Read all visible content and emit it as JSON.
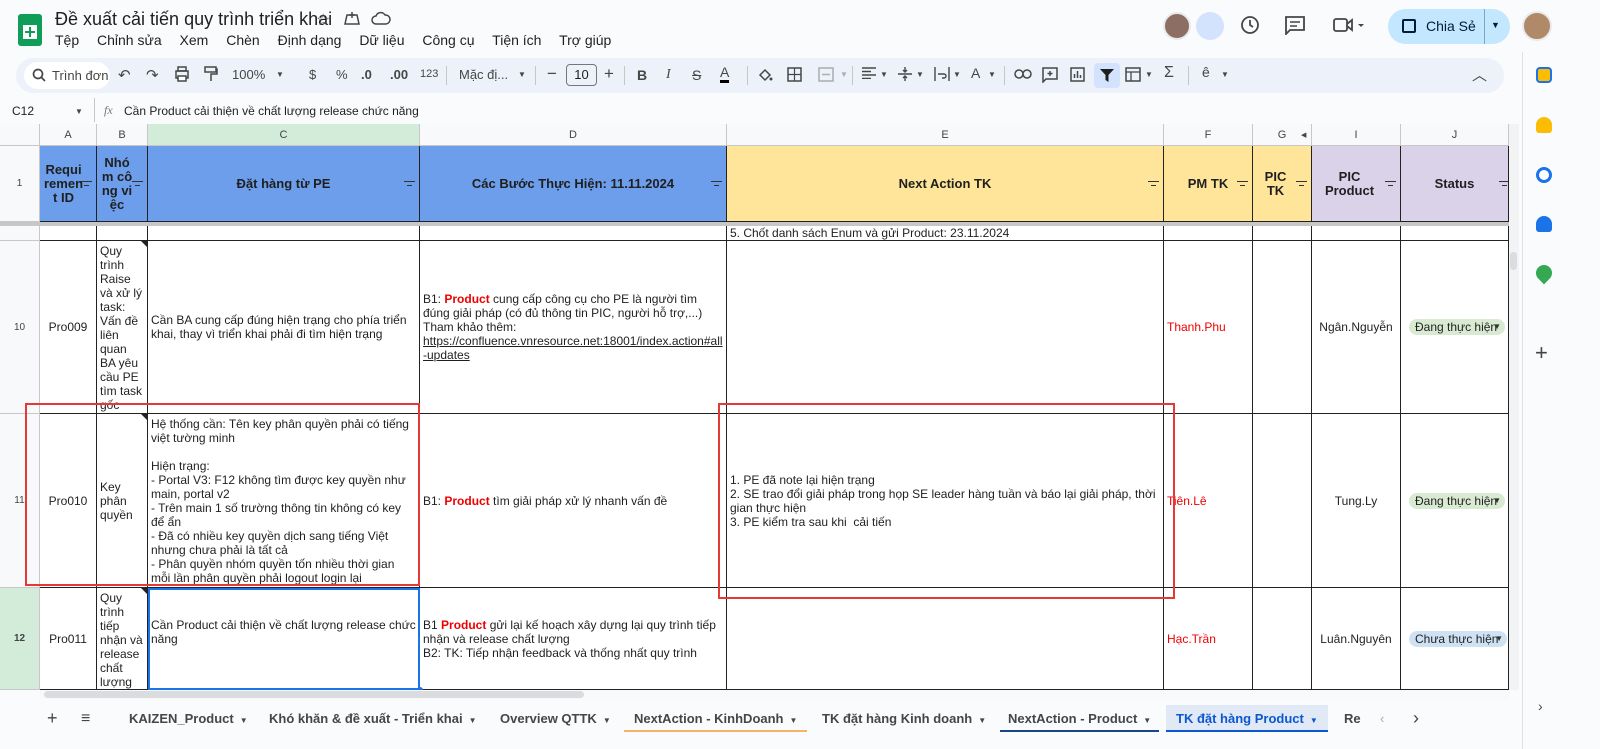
{
  "header": {
    "doc_title": "Đề xuất cải tiến quy trình triển khai",
    "share_label": "Chia Sẻ",
    "menus": [
      "Tệp",
      "Chỉnh sửa",
      "Xem",
      "Chèn",
      "Định dạng",
      "Dữ liệu",
      "Công cụ",
      "Tiện ích",
      "Trợ giúp"
    ]
  },
  "toolbar": {
    "search_placeholder": "Trình đơn",
    "zoom": "100%",
    "currency": "$",
    "percent": "%",
    "dec_decrease": ".0",
    "dec_increase": ".00",
    "number_format": "123",
    "font_name": "Mặc đị...",
    "font_size": "10"
  },
  "formula_bar": {
    "cell_ref": "C12",
    "fx": "fx",
    "content": "Cần Product cải thiện về chất lượng release chức năng"
  },
  "columns": [
    "A",
    "B",
    "C",
    "D",
    "E",
    "F",
    "G",
    "I",
    "J"
  ],
  "header_row": {
    "row_num": "1",
    "a": "Requirement ID",
    "b": "Nhóm công việc",
    "c": "Đặt hàng từ PE",
    "d": "Các Bước Thực Hiện: 11.11.2024",
    "e": "Next Action TK",
    "f": "PM TK",
    "g": "PIC TK",
    "i": "PIC Product",
    "j": "Status"
  },
  "partial_row": {
    "e": "5. Chốt danh sách Enum và gửi Product: 23.11.2024"
  },
  "rows": [
    {
      "row_num": "10",
      "id": "Pro009",
      "group": "Quy trình Raise và xử lý task: Vấn đề liên quan BA yêu cầu PE tìm task gốc",
      "order": "Cần BA cung cấp đúng hiện trạng cho phía triển khai, thay vì triển khai phải đi tìm hiện trạng",
      "steps_prefix": "B1: ",
      "steps_product": "Product",
      "steps_rest": " cung cấp công cụ cho PE là người tìm đúng giải pháp (có đủ thông tin PIC, người hỗ trợ,...)",
      "steps_line2": "Tham khảo thêm:",
      "steps_link": "https://confluence.vnresource.net:18001/index.action#all-updates",
      "next_action": "",
      "pm": "Thanh.Phu",
      "pic_tk": "",
      "pic_product": "Ngân.Nguyễn",
      "status": "Đang thực hiện"
    },
    {
      "row_num": "11",
      "id": "Pro010",
      "group": "Key phân quyền",
      "order": "Hệ thống cần: Tên key phân quyền phải có tiếng việt tường minh\n\nHiện trạng:\n- Portal V3: F12 không tìm được key quyền như main, portal v2\n- Trên main 1 số trường thông tin không có key để ẩn\n- Đã có nhiều key quyền dịch sang tiếng Việt nhưng chưa phải là tất cả\n- Phân quyền nhóm quyền tốn nhiều thời gian mỗi lần phân quyền phải logout login lại",
      "steps_prefix": "B1: ",
      "steps_product": "Product",
      "steps_rest": " tìm giải pháp xử lý nhanh vấn đề",
      "next_action": "1. PE đã note lại hiện trạng\n2. SE trao đổi giải pháp trong họp SE leader hàng tuần và báo lại giải pháp, thời gian thực hiện\n3. PE kiểm tra sau khi  cải tiến",
      "pm": "Tiên.Lê",
      "pic_tk": "",
      "pic_product": "Tung.Ly",
      "status": "Đang thực hiện"
    },
    {
      "row_num": "12",
      "id": "Pro011",
      "group": "Quy trình tiếp nhận và release chất lượng",
      "order": "Cần Product cải thiện về chất lượng release chức năng",
      "steps_prefix": "B1 ",
      "steps_product": "Product",
      "steps_rest": " gửi lại kế hoạch xây dựng lại quy trình tiếp nhận và release chất lượng",
      "steps_line2": "B2: TK: Tiếp nhận feedback và thống nhất quy trình",
      "next_action": "",
      "pm": "Hạc.Trần",
      "pic_tk": "",
      "pic_product": "Luân.Nguyên",
      "status": "Chưa thực hiện"
    }
  ],
  "tabs": [
    "KAIZEN_Product",
    "Khó khăn & đề xuất - Triển khai",
    "Overview QTTK",
    "NextAction - KinhDoanh",
    "TK đặt hàng Kinh doanh",
    "NextAction - Product",
    "TK đặt hàng Product",
    "Re"
  ],
  "active_tab": "TK đặt hàng Product",
  "colors": {
    "blue_header": "#6d9eeb",
    "yellow_header": "#ffe599",
    "purple_header": "#d9d2e9",
    "status_green": "#d9ead3",
    "status_blue": "#cfe2f3",
    "share_bg": "#c2e7ff",
    "annotation_red": "#e53935"
  },
  "icons": [
    "star-icon",
    "move-icon",
    "cloud-icon",
    "history-icon",
    "comment-icon",
    "video-icon",
    "undo-icon",
    "redo-icon",
    "print-icon",
    "paint-format-icon",
    "bold-icon",
    "italic-icon",
    "strikethrough-icon",
    "text-color-icon",
    "fill-color-icon",
    "borders-icon",
    "merge-icon",
    "align-icon",
    "link-icon",
    "filter-icon",
    "functions-icon"
  ]
}
